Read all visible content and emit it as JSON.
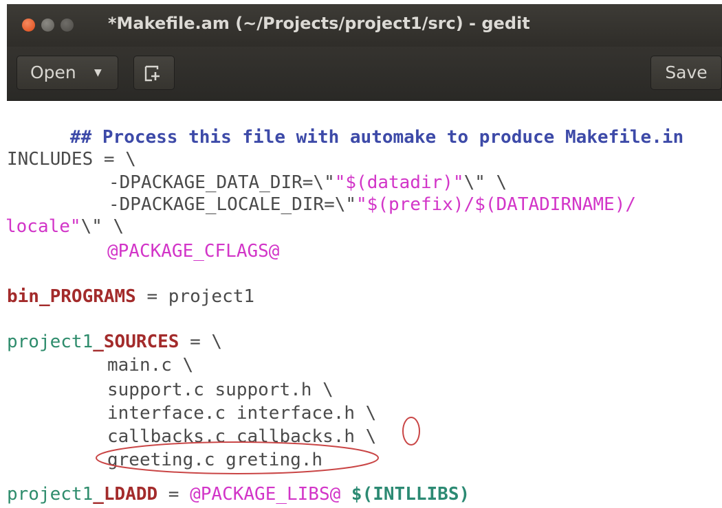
{
  "window": {
    "title": "*Makefile.am (~/Projects/project1/src) - gedit",
    "controls": {
      "close": "×",
      "minimize": "–",
      "maximize": "□"
    }
  },
  "header": {
    "open_label": "Open",
    "open_chevron": "▼",
    "new_tab_icon": "new-document-icon",
    "save_label": "Save"
  },
  "editor": {
    "comment": "## Process this file with automake to produce Makefile.in",
    "includes_name": "INCLUDES",
    "includes_op": " = \\",
    "pkg_data_prefix": "-DPACKAGE_DATA_DIR=\\\"",
    "pkg_data_str": "\"$(datadir)\"",
    "pkg_data_suffix": "\\\" \\",
    "pkg_locale_prefix": "-DPACKAGE_LOCALE_DIR=\\\"",
    "pkg_locale_str": "\"$(prefix)/$(DATADIRNAME)/",
    "locale_str": "locale\"",
    "locale_suffix": "\\\" \\",
    "pkg_cflags": "@PACKAGE_CFLAGS@",
    "bin_kw": "bin_PROGRAMS",
    "bin_rest": " = project1",
    "sources_prefix": "project1",
    "sources_kw": "_SOURCES",
    "sources_op": " = \\",
    "src_main": "main.c \\",
    "src_support": "support.c support.h \\",
    "src_interface": "interface.c interface.h \\",
    "src_callbacks": "callbacks.c callbacks.h \\",
    "src_greeting": "greeting.c greting.h",
    "ldadd_prefix": "project1",
    "ldadd_kw": "_LDADD",
    "ldadd_op": " = ",
    "ldadd_libs": "@PACKAGE_LIBS@",
    "ldadd_intl": " $(INTLLIBS)"
  },
  "colors": {
    "titlebar": "#2f2d29",
    "close_button": "#df4a18",
    "comment": "#3d4aa8",
    "string": "#d235c8",
    "keyword_red": "#a32b2b",
    "keyword_teal": "#2c8a73",
    "annotation": "#c94545"
  }
}
